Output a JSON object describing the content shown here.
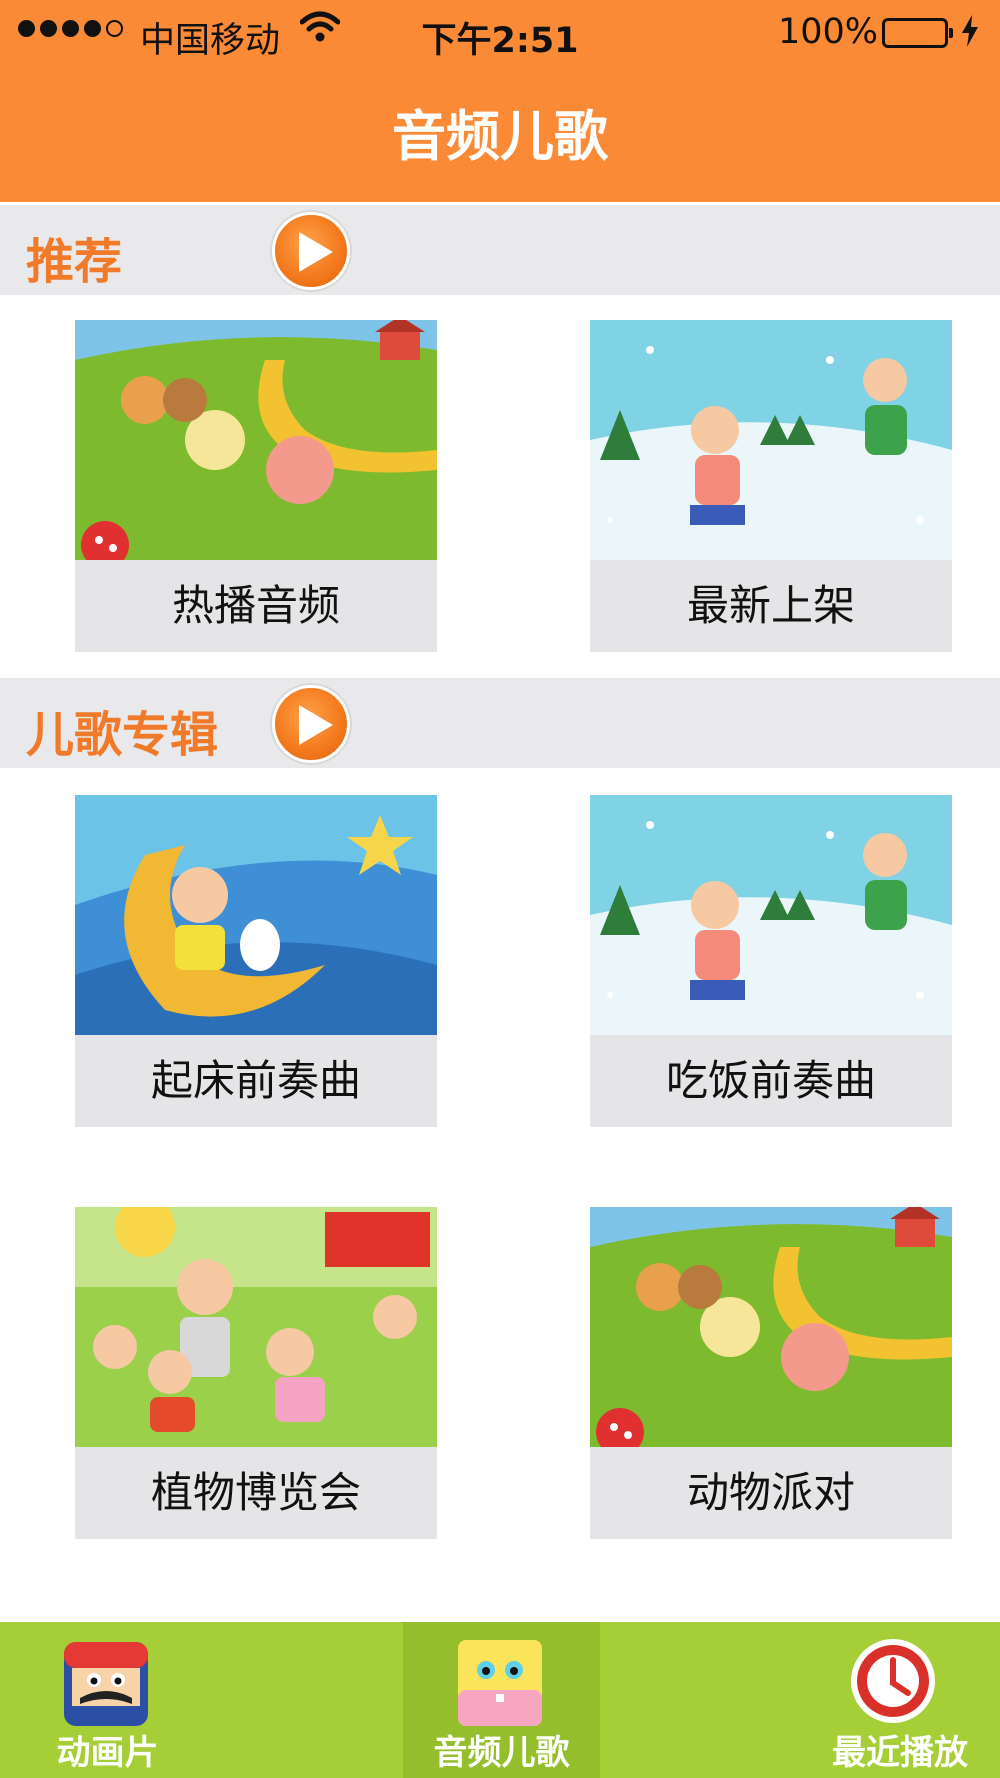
{
  "status_bar": {
    "carrier": "中国移动",
    "time": "下午2:51",
    "battery": "100%",
    "battery_level": 1.0,
    "signal_bars": 4,
    "icons": [
      "wifi-icon",
      "battery-icon",
      "charging-bolt-icon"
    ]
  },
  "nav": {
    "title": "音频儿歌"
  },
  "sections": [
    {
      "title": "推荐",
      "icon": "play-icon",
      "items": [
        {
          "label": "热播音频",
          "image": "animals-meadow-illustration"
        },
        {
          "label": "最新上架",
          "image": "kids-snow-illustration"
        }
      ]
    },
    {
      "title": "儿歌专辑",
      "icon": "play-icon",
      "items": [
        {
          "label": "起床前奏曲",
          "image": "moon-boy-rabbit-illustration"
        },
        {
          "label": "吃饭前奏曲",
          "image": "kids-snow-illustration"
        },
        {
          "label": "植物博览会",
          "image": "tree-planting-illustration"
        },
        {
          "label": "动物派对",
          "image": "animals-meadow-illustration"
        }
      ]
    }
  ],
  "tabs": [
    {
      "label": "动画片",
      "icon": "mario-face-icon",
      "active": false
    },
    {
      "label": "音频儿歌",
      "icon": "doll-face-icon",
      "active": true
    },
    {
      "label": "最近播放",
      "icon": "clock-icon",
      "active": false
    }
  ],
  "colors": {
    "header": "#FA8A35",
    "section_bg": "#E9E9EB",
    "section_title": "#F07A2A",
    "card_label_bg": "#E5E5E7",
    "tabbar": "#A5CE37"
  }
}
